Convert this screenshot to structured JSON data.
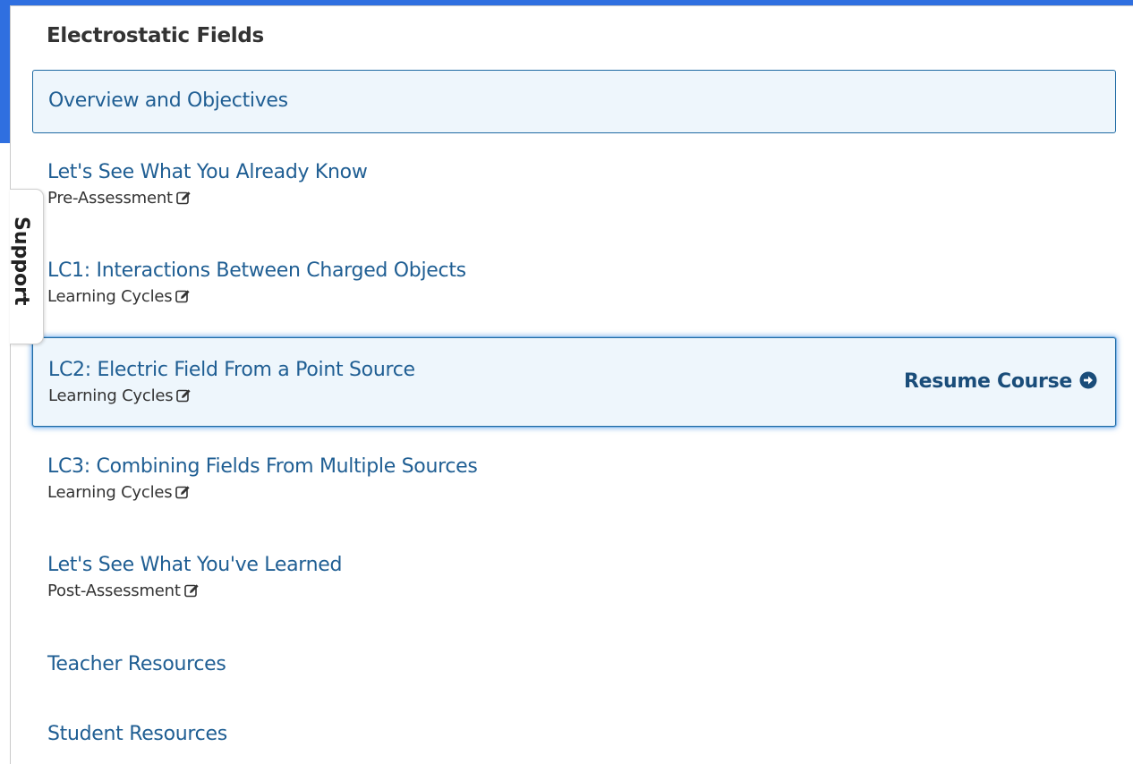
{
  "outline": {
    "section_title": "Electrostatic Fields",
    "items": [
      {
        "title": "Overview and Objectives",
        "subtitle": ""
      },
      {
        "title": "Let's See What You Already Know",
        "subtitle": "Pre-Assessment"
      },
      {
        "title": "LC1: Interactions Between Charged Objects",
        "subtitle": "Learning Cycles"
      },
      {
        "title": "LC2: Electric Field From a Point Source",
        "subtitle": "Learning Cycles"
      },
      {
        "title": "LC3: Combining Fields From Multiple Sources",
        "subtitle": "Learning Cycles"
      },
      {
        "title": "Let's See What You've Learned",
        "subtitle": "Post-Assessment"
      },
      {
        "title": "Teacher Resources",
        "subtitle": ""
      },
      {
        "title": "Student Resources",
        "subtitle": ""
      }
    ]
  },
  "resume": {
    "label": "Resume Course",
    "icon": "arrow-circle-right-icon"
  },
  "support_tab": {
    "label": "Support"
  },
  "icons": {
    "subtitle_icon": "edit-icon"
  },
  "colors": {
    "background_accent": "#2f6fe0",
    "link": "#1f5e93",
    "highlight_bg": "#eef6fc",
    "highlight_border": "#1f6aa3",
    "resume_text": "#1a4d7a"
  }
}
